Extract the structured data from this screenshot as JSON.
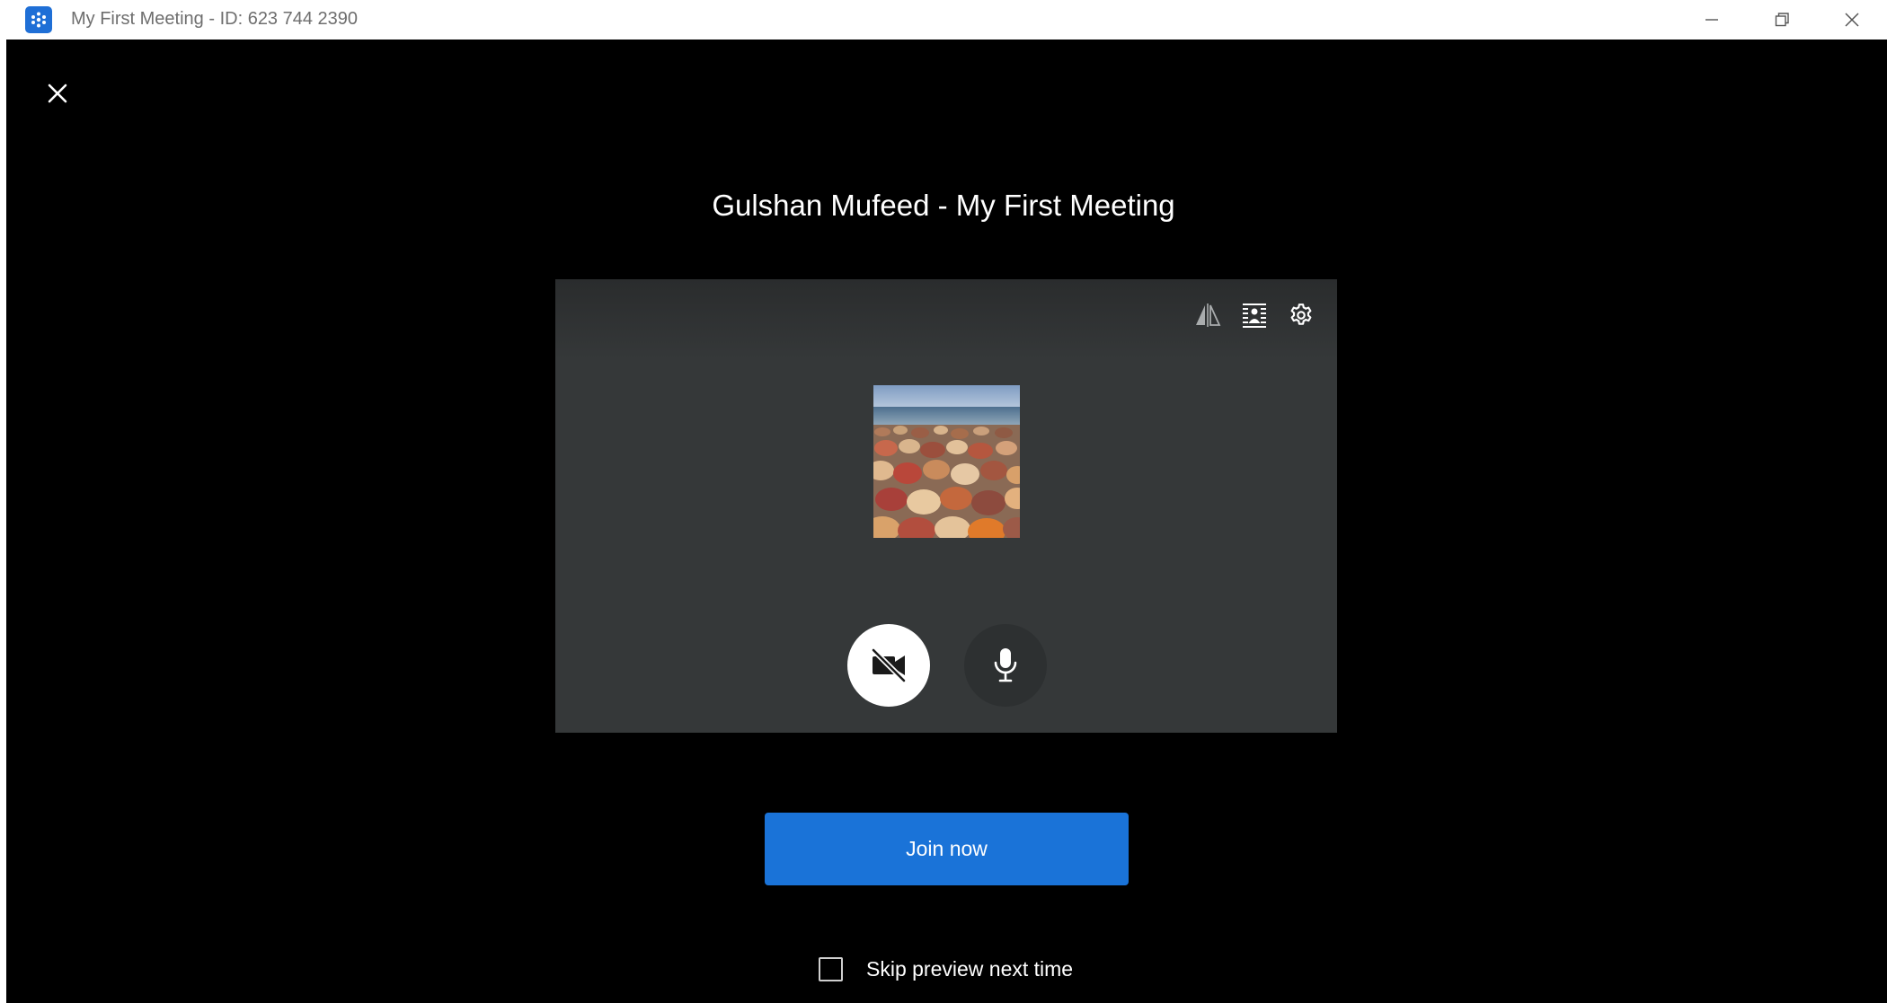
{
  "window": {
    "title": "My First Meeting - ID: 623 744 2390",
    "app_icon": "app-logo-icon",
    "controls": {
      "minimize_icon": "minimize-icon",
      "maximize_icon": "restore-icon",
      "close_icon": "close-icon"
    }
  },
  "preview_screen": {
    "close_icon": "close-icon",
    "meeting_title": "Gulshan Mufeed - My First Meeting",
    "toolbar": {
      "mirror_icon": "mirror-video-icon",
      "background_icon": "background-effects-icon",
      "settings_icon": "gear-icon"
    },
    "avatar_image": "pebbles-beach-photo",
    "camera_button": {
      "icon": "camera-off-icon",
      "state": "off"
    },
    "mic_button": {
      "icon": "microphone-icon",
      "state": "on"
    },
    "join_button_label": "Join now",
    "skip_preview": {
      "label": "Skip preview next time",
      "checked": false
    }
  },
  "colors": {
    "accent": "#1a73d8",
    "background": "#000000",
    "preview_panel": "#353839"
  }
}
